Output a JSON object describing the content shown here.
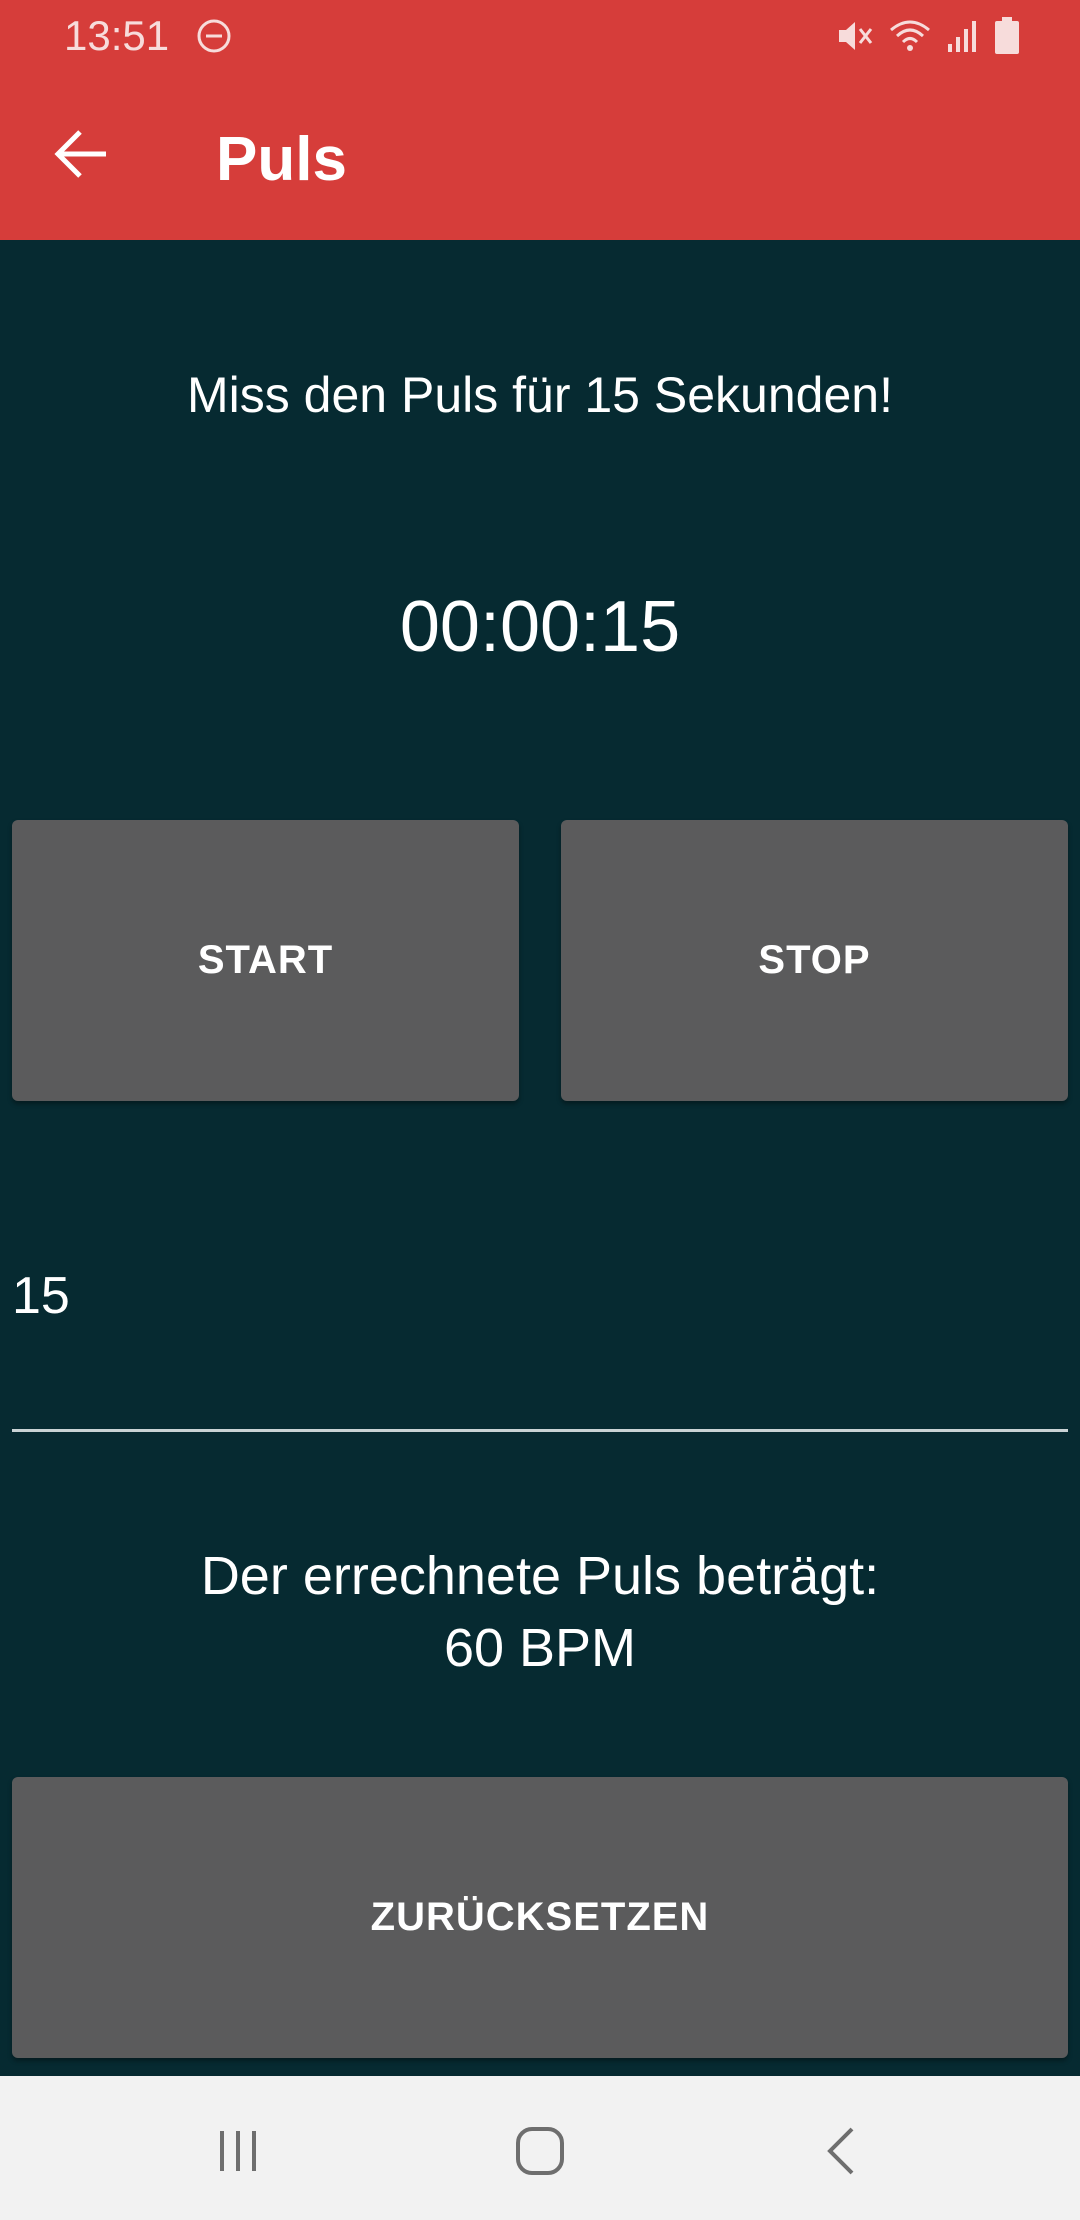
{
  "status_bar": {
    "time": "13:51",
    "icons": [
      "do-not-disturb-icon",
      "mute-icon",
      "wifi-icon",
      "signal-icon",
      "battery-icon"
    ]
  },
  "app_bar": {
    "title": "Puls",
    "back_icon": "arrow-left-icon",
    "background_color": "#d63d3a"
  },
  "main": {
    "instruction": "Miss den Puls für 15 Sekunden!",
    "timer": "00:00:15",
    "start_label": "START",
    "stop_label": "STOP",
    "count_value": "15",
    "result_line1": "Der errechnete Puls beträgt:",
    "result_line2": "60 BPM",
    "reset_label": "ZURÜCKSETZEN",
    "background_color": "#062a31",
    "button_color": "#5b5b5c"
  },
  "nav_bar": {
    "icons": [
      "recent-apps-icon",
      "home-icon",
      "back-nav-icon"
    ]
  }
}
